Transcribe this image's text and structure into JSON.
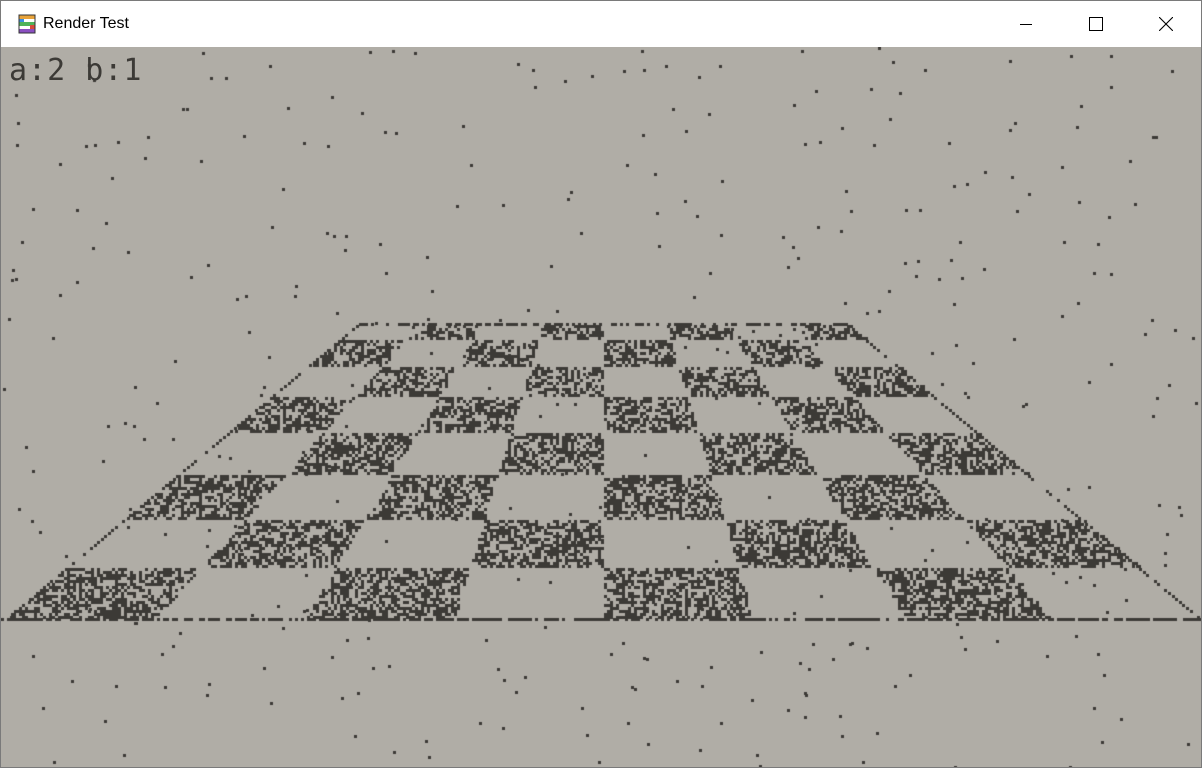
{
  "window": {
    "title": "Render Test",
    "app_icon": "app-logo-icon"
  },
  "caption_buttons": {
    "minimize_icon": "minimize-icon",
    "maximize_icon": "maximize-icon",
    "close_icon": "close-icon"
  },
  "viewport": {
    "counter_text": "a:2 b:1",
    "background_color": "#b0ada6",
    "ink_color": "#3c3a36",
    "scene": "dithered checkerboard floor in perspective with scattered star dots",
    "board_columns": 8,
    "board_rows": 8
  }
}
